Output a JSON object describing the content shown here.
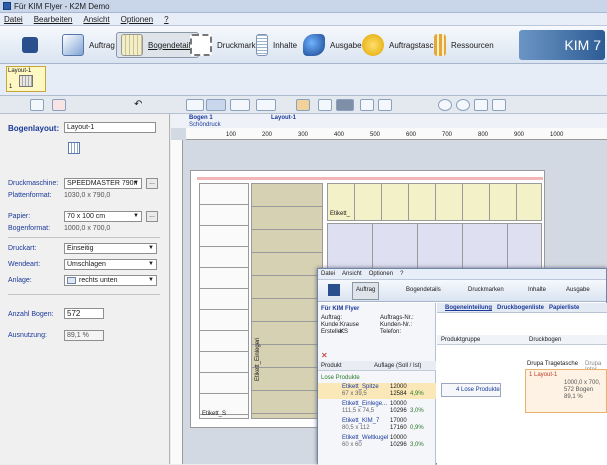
{
  "window": {
    "title": "Für KIM Flyer - K2M Demo"
  },
  "menu": {
    "items": [
      "Datei",
      "Bearbeiten",
      "Ansicht",
      "Optionen",
      "?"
    ]
  },
  "ribbon": {
    "auftrag": "Auftrag",
    "bogendetails": "Bogendetails",
    "druckmarken": "Druckmarken",
    "inhalte": "Inhalte",
    "ausgabe": "Ausgabe",
    "auftragstasche": "Auftragstasche",
    "ressourcen": "Ressourcen",
    "logo": "KIM 7"
  },
  "layout": {
    "thumb_label": "Layout-1",
    "thumb_num": "1"
  },
  "left": {
    "bogenlayout_label": "Bogenlayout:",
    "bogenlayout_value": "Layout-1",
    "druckmaschine_label": "Druckmaschine:",
    "druckmaschine_value": "SPEEDMASTER 790n",
    "plattenformat_label": "Plattenformat:",
    "plattenformat_value": "1030,0 x 790,0",
    "papier_label": "Papier:",
    "papier_value": "70 x 100 cm",
    "bogenformat_label": "Bogenformat:",
    "bogenformat_value": "1000,0 x 700,0",
    "druckart_label": "Druckart:",
    "druckart_value": "Einseitig",
    "wendeart_label": "Wendeart:",
    "wendeart_value": "Umschlagen",
    "anlage_label": "Anlage:",
    "anlage_value": "rechts unten",
    "anzahl_label": "Anzahl Bogen:",
    "anzahl_value": "572",
    "ausnutzung_label": "Ausnutzung:",
    "ausnutzung_value": "89,1 %",
    "dots": "..."
  },
  "canvas": {
    "bogen": "Bogen 1",
    "schoendruck": "Schöndruck",
    "layout_name": "Layout-1",
    "ruler_ticks": [
      "100",
      "200",
      "300",
      "400",
      "500",
      "600",
      "700",
      "800",
      "900",
      "1000"
    ],
    "labels": {
      "etikett_top": "Etikett_",
      "etikett_bottom": "Etikett_S",
      "etikett_v": "Etikett_Einlegeri"
    }
  },
  "dialog": {
    "menu": [
      "Datei",
      "Ansicht",
      "Optionen",
      "?"
    ],
    "ribbon": [
      "Auftrag",
      "Bogendetails",
      "Druckmarken",
      "Inhalte",
      "Ausgabe"
    ],
    "header": "Für KIM Flyer",
    "fields": [
      {
        "l": "Auftrag:",
        "v": ""
      },
      {
        "l": "Kunde:",
        "v": "Krause"
      },
      {
        "l": "Ersteller:",
        "v": "KS"
      }
    ],
    "fields_right": [
      "Auftrags-Nr.:",
      "Kunden-Nr.:",
      "Telefon:"
    ],
    "tabs": [
      "Bogeneinteilung",
      "Druckbogenliste",
      "Papierliste"
    ],
    "table_head": {
      "produkt": "Produkt",
      "auflage": "Auflage (Soll / Ist)"
    },
    "group": "Lose Produkte",
    "rows": [
      {
        "name": "Etikett_Spitze",
        "dim": "67 x 39,5",
        "soll": "12000",
        "ist": "12584",
        "pct": "4,9%"
      },
      {
        "name": "Etikett_Einlege...",
        "dim": "111,5 x 74,5",
        "soll": "10000",
        "ist": "10296",
        "pct": "3,0%"
      },
      {
        "name": "Etikett_KIM_7",
        "dim": "80,5 x 112",
        "soll": "17000",
        "ist": "17160",
        "pct": "0,9%"
      },
      {
        "name": "Etikett_Weltkugel",
        "dim": "60 x 60",
        "soll": "10000",
        "ist": "10296",
        "pct": "3,0%"
      }
    ],
    "right_headers": {
      "produktgruppe": "Produktgruppe",
      "druckbogen": "Druckbogen"
    },
    "lose": "4 Lose Produkte",
    "druckbogen_title": "Drupa Tragetasche",
    "druckbogen_sub": "Drupa Inter",
    "druckbogen_layout": "1 Layout-1",
    "druckbogen_info": [
      "1000,0 x 700,",
      "572 Bogen",
      "89,1 %"
    ]
  }
}
